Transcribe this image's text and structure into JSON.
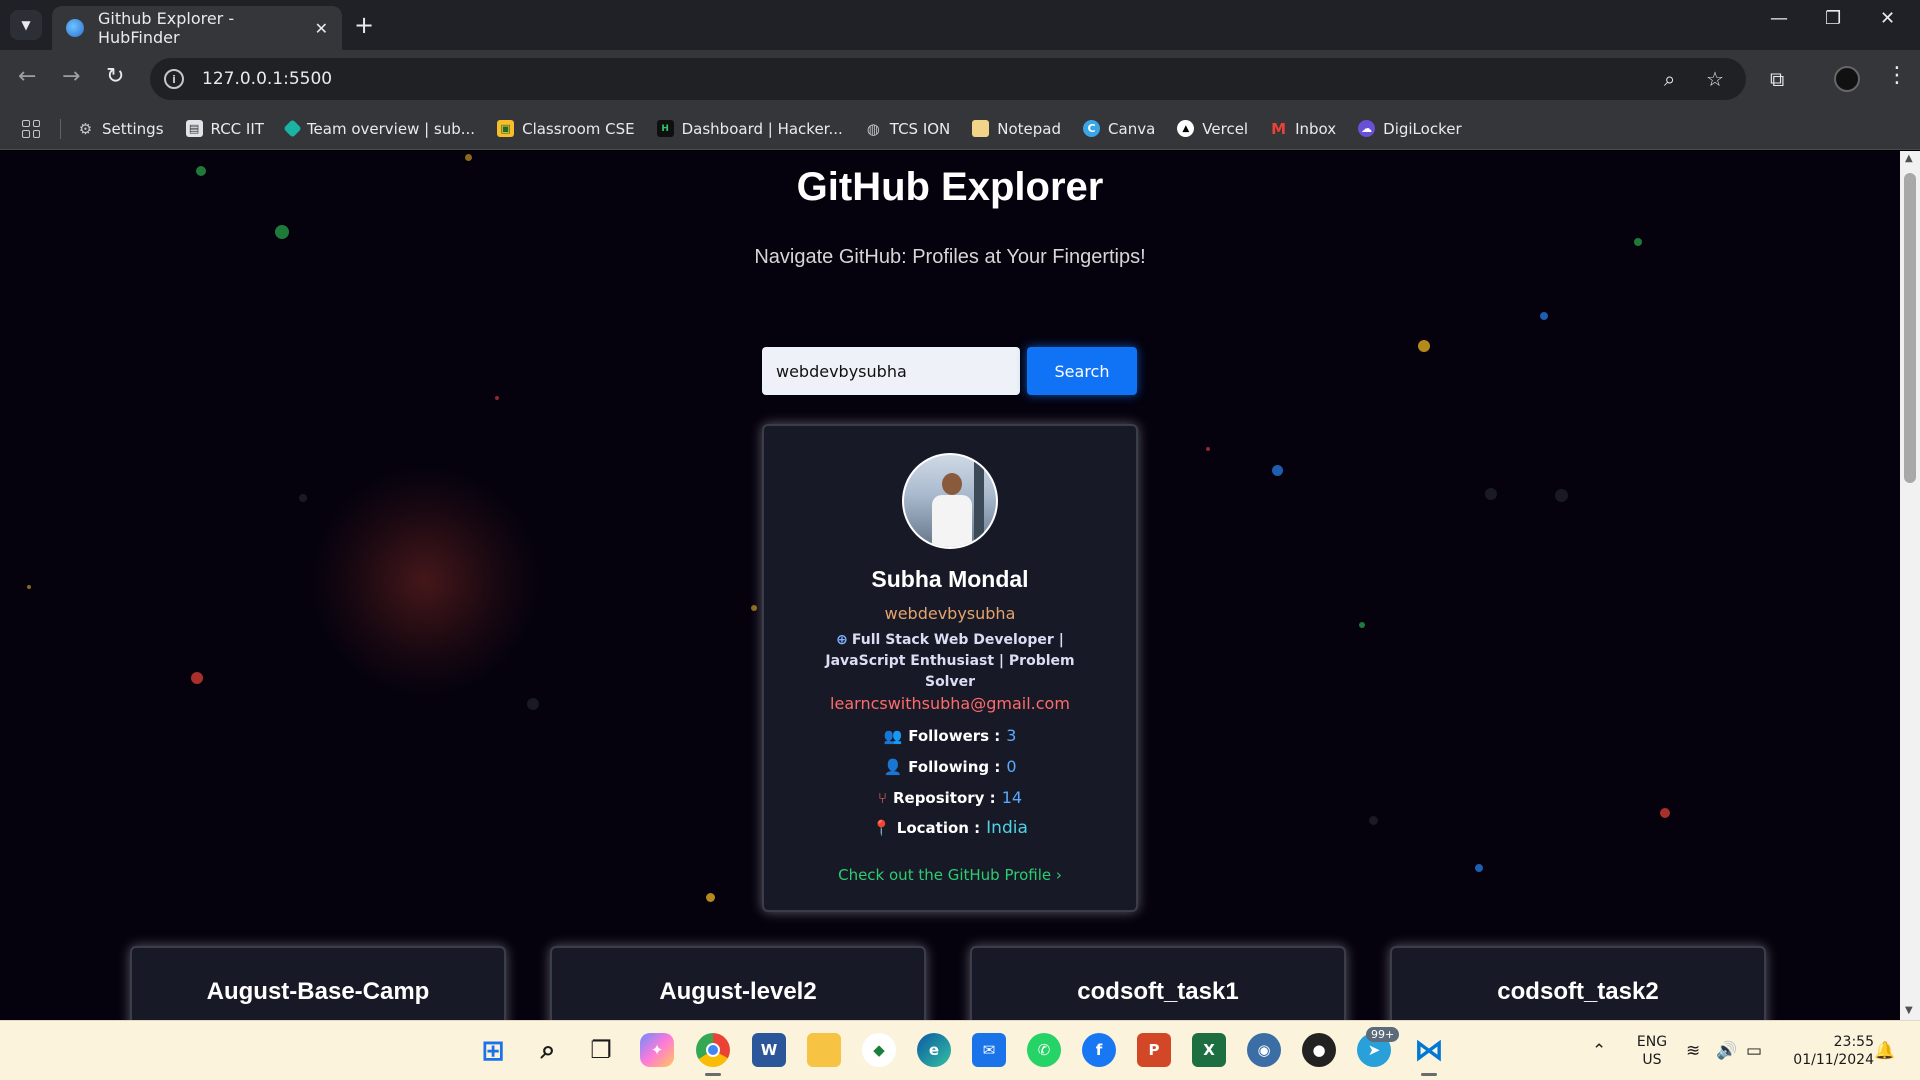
{
  "browser": {
    "tab_title": "Github Explorer - HubFinder",
    "url": "127.0.0.1:5500",
    "bookmarks": [
      {
        "label": "Settings",
        "icon": "gear-icon"
      },
      {
        "label": "RCC IIT",
        "icon": "document-icon"
      },
      {
        "label": "Team overview | sub...",
        "icon": "diamond-icon"
      },
      {
        "label": "Classroom CSE",
        "icon": "classroom-icon"
      },
      {
        "label": "Dashboard | Hacker...",
        "icon": "hackerrank-icon"
      },
      {
        "label": "TCS ION",
        "icon": "globe-icon"
      },
      {
        "label": "Notepad",
        "icon": "folder-icon"
      },
      {
        "label": "Canva",
        "icon": "canva-icon"
      },
      {
        "label": "Vercel",
        "icon": "vercel-icon"
      },
      {
        "label": "Inbox",
        "icon": "gmail-icon"
      },
      {
        "label": "DigiLocker",
        "icon": "digilocker-icon"
      }
    ]
  },
  "page": {
    "title": "GitHub Explorer",
    "subtitle": "Navigate GitHub: Profiles at Your Fingertips!",
    "search": {
      "value": "webdevbysubha",
      "button": "Search"
    }
  },
  "profile": {
    "name": "Subha Mondal",
    "username": "webdevbysubha",
    "bio": "Full Stack Web Developer | JavaScript Enthusiast | Problem Solver",
    "email": "learncswithsubha@gmail.com",
    "stats": {
      "followers_label": "Followers :",
      "followers": "3",
      "following_label": "Following :",
      "following": "0",
      "repository_label": "Repository :",
      "repository": "14",
      "location_label": "Location :",
      "location": "India"
    },
    "link": "Check out the GitHub Profile ›"
  },
  "repos": [
    "August-Base-Camp",
    "August-level2",
    "codsoft_task1",
    "codsoft_task2"
  ],
  "taskbar": {
    "notification_badge": "99+",
    "lang_line1": "ENG",
    "lang_line2": "US",
    "time": "23:55",
    "date": "01/11/2024"
  },
  "colors": {
    "accent_blue": "#1073f5",
    "email_red": "#ff6b6b",
    "link_green": "#2ecc71",
    "username_orange": "#e6a26b"
  }
}
